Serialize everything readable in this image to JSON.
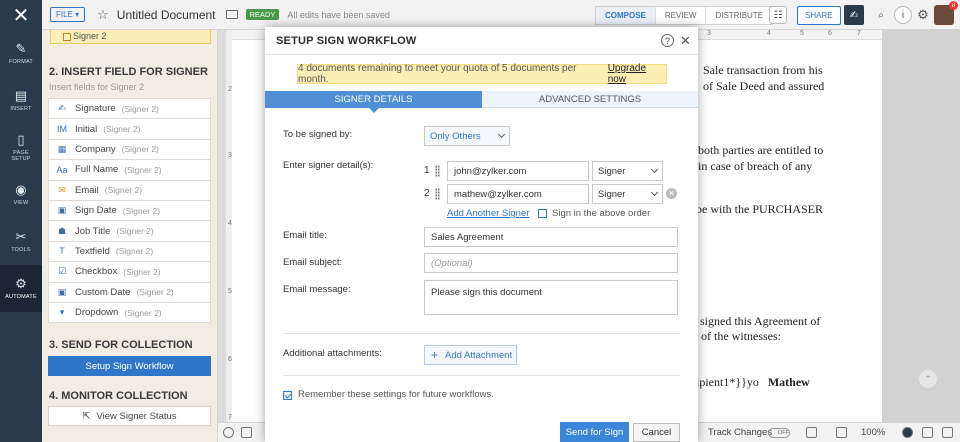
{
  "rail": {
    "items": [
      {
        "label": "FORMAT",
        "icon": "format-icon"
      },
      {
        "label": "INSERT",
        "icon": "insert-icon"
      },
      {
        "label": "PAGE SETUP",
        "icon": "page-setup-icon"
      },
      {
        "label": "VIEW",
        "icon": "view-icon"
      },
      {
        "label": "TOOLS",
        "icon": "tools-icon"
      },
      {
        "label": "AUTOMATE",
        "icon": "automate-icon"
      }
    ]
  },
  "header": {
    "file_label": "FILE ▾",
    "doc_title": "Untitled Document",
    "ready_badge": "READY",
    "save_status": "All edits have been saved",
    "modes": [
      "COMPOSE",
      "REVIEW",
      "DISTRIBUTE"
    ],
    "share_label": "SHARE",
    "notification_count": "8"
  },
  "panel": {
    "signer_chip": "Signer 2",
    "insert_title": "2. INSERT FIELD FOR SIGNER",
    "insert_subtitle": "Insert fields for Signer 2",
    "fields": [
      {
        "label": "Signature",
        "who": "(Signer 2)",
        "icon": "signature-icon"
      },
      {
        "label": "Initial",
        "who": "(Signer 2)",
        "icon": "initial-icon"
      },
      {
        "label": "Company",
        "who": "(Signer 2)",
        "icon": "company-icon"
      },
      {
        "label": "Full Name",
        "who": "(Signer 2)",
        "icon": "full-name-icon"
      },
      {
        "label": "Email",
        "who": "(Signer 2)",
        "icon": "email-icon"
      },
      {
        "label": "Sign Date",
        "who": "(Signer 2)",
        "icon": "calendar-icon"
      },
      {
        "label": "Job Title",
        "who": "(Signer 2)",
        "icon": "job-title-icon"
      },
      {
        "label": "Textfield",
        "who": "(Signer 2)",
        "icon": "textfield-icon"
      },
      {
        "label": "Checkbox",
        "who": "(Signer 2)",
        "icon": "checkbox-icon"
      },
      {
        "label": "Custom Date",
        "who": "(Signer 2)",
        "icon": "calendar-icon"
      },
      {
        "label": "Dropdown",
        "who": "(Signer 2)",
        "icon": "dropdown-icon"
      }
    ],
    "send_title": "3. SEND FOR COLLECTION",
    "workflow_button": "Setup Sign Workflow",
    "monitor_title": "4. MONITOR COLLECTION",
    "status_button": "View Signer Status"
  },
  "doc": {
    "lines": [
      "Sale transaction from his",
      "of Sale Deed and assured",
      "both parties are entitled to",
      "in  case  of  breach  of  any",
      "be with the PURCHASER",
      "signed this Agreement of",
      "of the witnesses:",
      "ipient1*}}yo"
    ],
    "bold_name": "Mathew",
    "hruler_marks": [
      "3",
      "4",
      "5",
      "6",
      "7"
    ],
    "vruler_marks": [
      "2",
      "3",
      "4",
      "5",
      "6",
      "7"
    ]
  },
  "status": {
    "track_label": "Track Changes",
    "toggle_label": "OFF",
    "zoom": "100%"
  },
  "modal": {
    "title": "SETUP SIGN WORKFLOW",
    "quota_text": "4 documents remaining to meet your quota of 5 documents per month.",
    "upgrade_link": "Upgrade now",
    "tabs": [
      "SIGNER DETAILS",
      "ADVANCED SETTINGS"
    ],
    "signed_by_label": "To be signed by:",
    "signed_by_value": "Only Others",
    "signer_details_label": "Enter signer detail(s):",
    "signers": [
      {
        "num": "1",
        "email": "john@zylker.com",
        "role": "Signer"
      },
      {
        "num": "2",
        "email": "mathew@zylker.com",
        "role": "Signer"
      }
    ],
    "add_signer_link": "Add Another Signer",
    "order_label": "Sign in the above order",
    "email_title_label": "Email title:",
    "email_title_value": "Sales Agreement",
    "email_subject_label": "Email subject:",
    "email_subject_placeholder": "(Optional)",
    "email_message_label": "Email message:",
    "email_message_value": "Please sign this document",
    "attachments_label": "Additional attachments:",
    "attach_button": "Add Attachment",
    "remember_label": "Remember these settings for future workflows.",
    "send_button": "Send for Sign",
    "cancel_button": "Cancel"
  }
}
